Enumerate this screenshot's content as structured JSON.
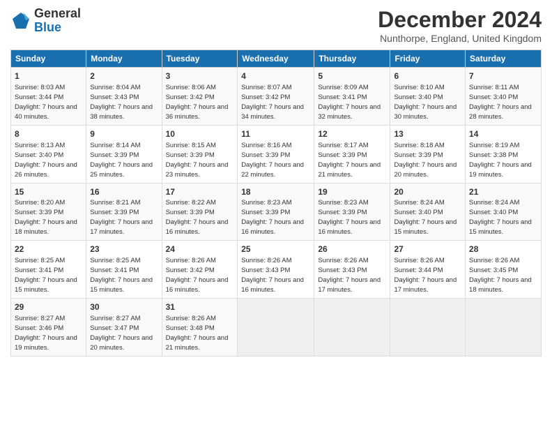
{
  "logo": {
    "line1": "General",
    "line2": "Blue"
  },
  "title": "December 2024",
  "subtitle": "Nunthorpe, England, United Kingdom",
  "headers": [
    "Sunday",
    "Monday",
    "Tuesday",
    "Wednesday",
    "Thursday",
    "Friday",
    "Saturday"
  ],
  "weeks": [
    [
      {
        "day": "1",
        "sunrise": "8:03 AM",
        "sunset": "3:44 PM",
        "daylight": "7 hours and 40 minutes."
      },
      {
        "day": "2",
        "sunrise": "8:04 AM",
        "sunset": "3:43 PM",
        "daylight": "7 hours and 38 minutes."
      },
      {
        "day": "3",
        "sunrise": "8:06 AM",
        "sunset": "3:42 PM",
        "daylight": "7 hours and 36 minutes."
      },
      {
        "day": "4",
        "sunrise": "8:07 AM",
        "sunset": "3:42 PM",
        "daylight": "7 hours and 34 minutes."
      },
      {
        "day": "5",
        "sunrise": "8:09 AM",
        "sunset": "3:41 PM",
        "daylight": "7 hours and 32 minutes."
      },
      {
        "day": "6",
        "sunrise": "8:10 AM",
        "sunset": "3:40 PM",
        "daylight": "7 hours and 30 minutes."
      },
      {
        "day": "7",
        "sunrise": "8:11 AM",
        "sunset": "3:40 PM",
        "daylight": "7 hours and 28 minutes."
      }
    ],
    [
      {
        "day": "8",
        "sunrise": "8:13 AM",
        "sunset": "3:40 PM",
        "daylight": "7 hours and 26 minutes."
      },
      {
        "day": "9",
        "sunrise": "8:14 AM",
        "sunset": "3:39 PM",
        "daylight": "7 hours and 25 minutes."
      },
      {
        "day": "10",
        "sunrise": "8:15 AM",
        "sunset": "3:39 PM",
        "daylight": "7 hours and 23 minutes."
      },
      {
        "day": "11",
        "sunrise": "8:16 AM",
        "sunset": "3:39 PM",
        "daylight": "7 hours and 22 minutes."
      },
      {
        "day": "12",
        "sunrise": "8:17 AM",
        "sunset": "3:39 PM",
        "daylight": "7 hours and 21 minutes."
      },
      {
        "day": "13",
        "sunrise": "8:18 AM",
        "sunset": "3:39 PM",
        "daylight": "7 hours and 20 minutes."
      },
      {
        "day": "14",
        "sunrise": "8:19 AM",
        "sunset": "3:38 PM",
        "daylight": "7 hours and 19 minutes."
      }
    ],
    [
      {
        "day": "15",
        "sunrise": "8:20 AM",
        "sunset": "3:39 PM",
        "daylight": "7 hours and 18 minutes."
      },
      {
        "day": "16",
        "sunrise": "8:21 AM",
        "sunset": "3:39 PM",
        "daylight": "7 hours and 17 minutes."
      },
      {
        "day": "17",
        "sunrise": "8:22 AM",
        "sunset": "3:39 PM",
        "daylight": "7 hours and 16 minutes."
      },
      {
        "day": "18",
        "sunrise": "8:23 AM",
        "sunset": "3:39 PM",
        "daylight": "7 hours and 16 minutes."
      },
      {
        "day": "19",
        "sunrise": "8:23 AM",
        "sunset": "3:39 PM",
        "daylight": "7 hours and 16 minutes."
      },
      {
        "day": "20",
        "sunrise": "8:24 AM",
        "sunset": "3:40 PM",
        "daylight": "7 hours and 15 minutes."
      },
      {
        "day": "21",
        "sunrise": "8:24 AM",
        "sunset": "3:40 PM",
        "daylight": "7 hours and 15 minutes."
      }
    ],
    [
      {
        "day": "22",
        "sunrise": "8:25 AM",
        "sunset": "3:41 PM",
        "daylight": "7 hours and 15 minutes."
      },
      {
        "day": "23",
        "sunrise": "8:25 AM",
        "sunset": "3:41 PM",
        "daylight": "7 hours and 15 minutes."
      },
      {
        "day": "24",
        "sunrise": "8:26 AM",
        "sunset": "3:42 PM",
        "daylight": "7 hours and 16 minutes."
      },
      {
        "day": "25",
        "sunrise": "8:26 AM",
        "sunset": "3:43 PM",
        "daylight": "7 hours and 16 minutes."
      },
      {
        "day": "26",
        "sunrise": "8:26 AM",
        "sunset": "3:43 PM",
        "daylight": "7 hours and 17 minutes."
      },
      {
        "day": "27",
        "sunrise": "8:26 AM",
        "sunset": "3:44 PM",
        "daylight": "7 hours and 17 minutes."
      },
      {
        "day": "28",
        "sunrise": "8:26 AM",
        "sunset": "3:45 PM",
        "daylight": "7 hours and 18 minutes."
      }
    ],
    [
      {
        "day": "29",
        "sunrise": "8:27 AM",
        "sunset": "3:46 PM",
        "daylight": "7 hours and 19 minutes."
      },
      {
        "day": "30",
        "sunrise": "8:27 AM",
        "sunset": "3:47 PM",
        "daylight": "7 hours and 20 minutes."
      },
      {
        "day": "31",
        "sunrise": "8:26 AM",
        "sunset": "3:48 PM",
        "daylight": "7 hours and 21 minutes."
      },
      null,
      null,
      null,
      null
    ]
  ],
  "labels": {
    "sunrise": "Sunrise:",
    "sunset": "Sunset:",
    "daylight": "Daylight:"
  }
}
